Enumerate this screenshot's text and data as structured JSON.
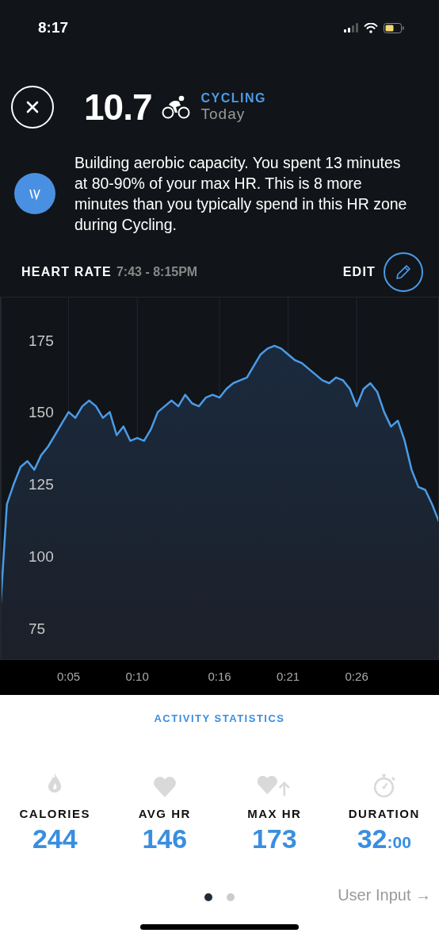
{
  "status_bar": {
    "time": "8:17"
  },
  "header": {
    "value": "10.7",
    "activity": "CYCLING",
    "date": "Today"
  },
  "insight": {
    "text": "Building aerobic capacity. You spent 13 minutes at 80-90% of your max HR. This is 8 more minutes than you typically spend in this HR zone during Cycling."
  },
  "heart_rate": {
    "title": "HEART RATE",
    "time_range": "7:43 - 8:15PM",
    "edit_label": "EDIT",
    "chart_data": {
      "type": "area",
      "grid": true,
      "xlim": [
        0,
        32
      ],
      "ylim": [
        64,
        190
      ],
      "yticks": [
        75,
        100,
        125,
        150,
        175
      ],
      "xticks": [
        {
          "value": 5,
          "label": "0:05"
        },
        {
          "value": 10,
          "label": "0:10"
        },
        {
          "value": 16,
          "label": "0:16"
        },
        {
          "value": 21,
          "label": "0:21"
        },
        {
          "value": 26,
          "label": "0:26"
        }
      ],
      "x": [
        0,
        0.5,
        1,
        1.5,
        2,
        2.5,
        3,
        3.5,
        4,
        4.5,
        5,
        5.5,
        6,
        6.5,
        7,
        7.5,
        8,
        8.5,
        9,
        9.5,
        10,
        10.5,
        11,
        11.5,
        12,
        12.5,
        13,
        13.5,
        14,
        14.5,
        15,
        15.5,
        16,
        16.5,
        17,
        17.5,
        18,
        18.5,
        19,
        19.5,
        20,
        20.5,
        21,
        21.5,
        22,
        22.5,
        23,
        23.5,
        24,
        24.5,
        25,
        25.5,
        26,
        26.5,
        27,
        27.5,
        28,
        28.5,
        29,
        29.5,
        30,
        30.5,
        31,
        31.5,
        32
      ],
      "series": [
        {
          "color": "#4a9be8",
          "values": [
            80,
            118,
            125,
            131,
            133,
            130,
            135,
            138,
            142,
            146,
            150,
            148,
            152,
            154,
            152,
            148,
            150,
            142,
            145,
            140,
            141,
            140,
            144,
            150,
            152,
            154,
            152,
            156,
            153,
            152,
            155,
            156,
            155,
            158,
            160,
            161,
            162,
            166,
            170,
            172,
            173,
            172,
            170,
            168,
            167,
            165,
            163,
            161,
            160,
            162,
            161,
            158,
            152,
            158,
            160,
            157,
            150,
            145,
            147,
            140,
            130,
            124,
            123,
            118,
            112
          ]
        }
      ]
    }
  },
  "statistics": {
    "title": "ACTIVITY STATISTICS",
    "items": [
      {
        "label": "CALORIES",
        "value": "244"
      },
      {
        "label": "AVG HR",
        "value": "146"
      },
      {
        "label": "MAX HR",
        "value": "173"
      },
      {
        "label": "DURATION",
        "value": "32",
        "value_suffix": ":00"
      }
    ]
  },
  "pager": [
    {
      "selected": true
    },
    {
      "selected": false
    }
  ],
  "user_input": {
    "label": "User Input",
    "arrow": "→"
  }
}
